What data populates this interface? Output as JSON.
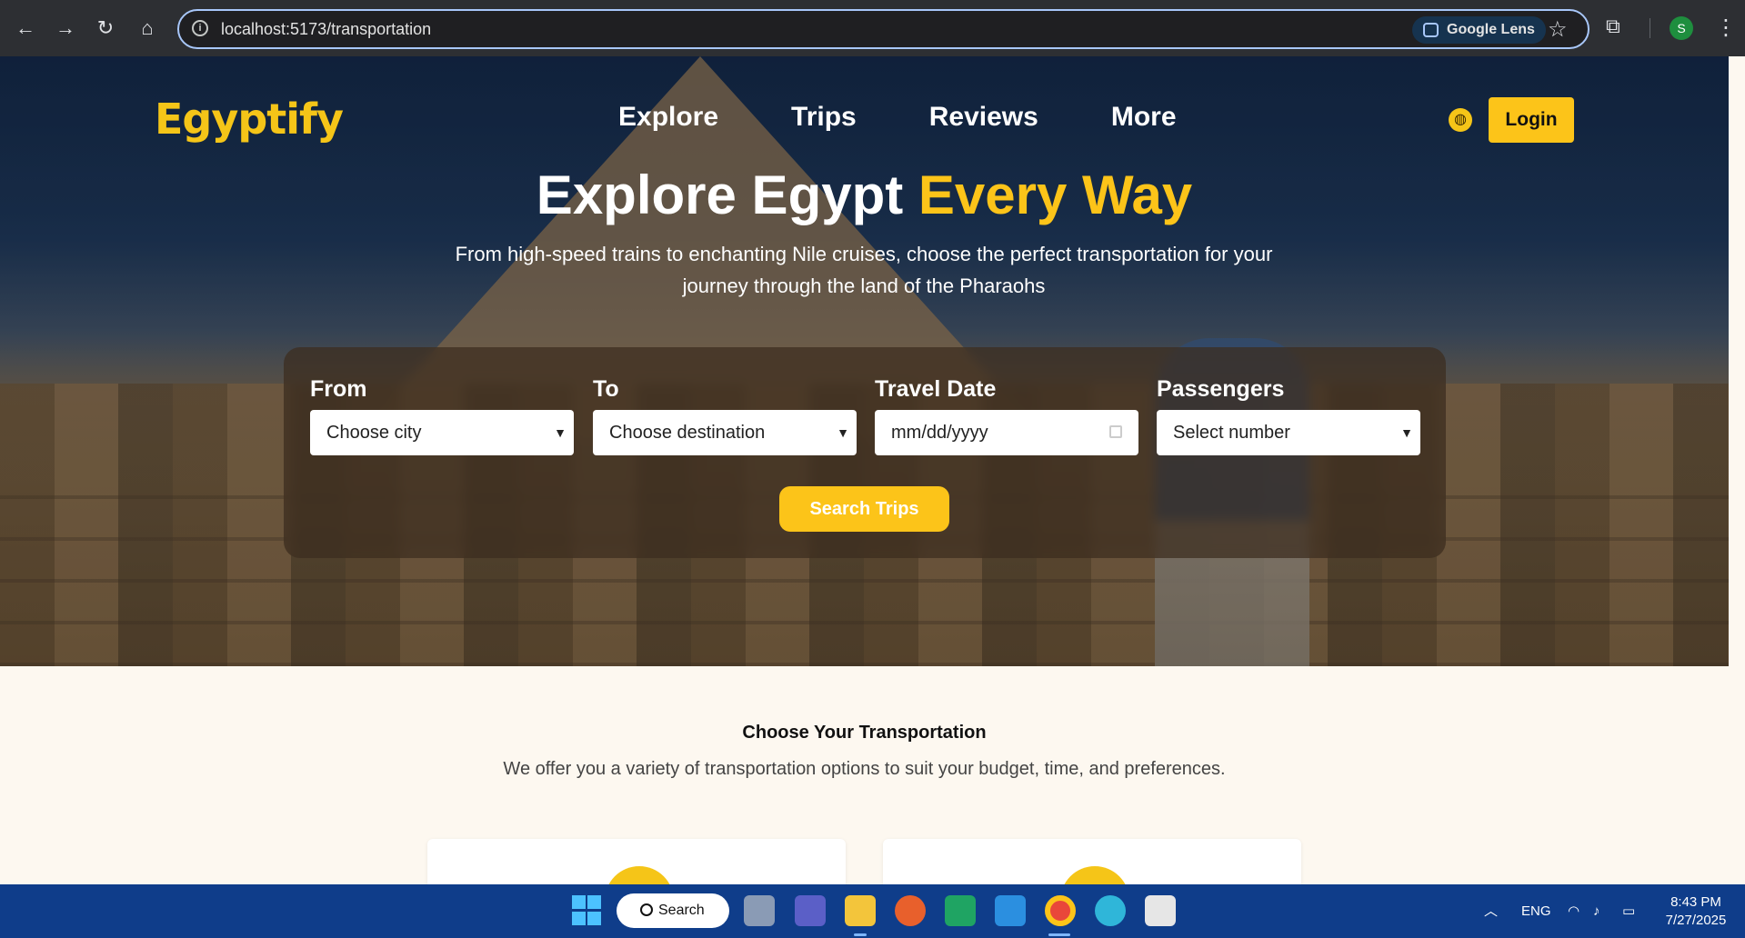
{
  "browser": {
    "url": "localhost:5173/transportation",
    "lens_label": "Google Lens",
    "profile_initial": "S"
  },
  "header": {
    "logo_text": "Egyptify",
    "nav": [
      "Explore",
      "Trips",
      "Reviews",
      "More"
    ],
    "login_label": "Login"
  },
  "hero": {
    "title_main": "Explore Egypt",
    "title_accent": "Every Way",
    "subtitle": "From high-speed trains to enchanting Nile cruises, choose the perfect transportation for your journey through the land of the Pharaohs"
  },
  "search_form": {
    "from_label": "From",
    "from_value": "Choose city",
    "to_label": "To",
    "to_value": "Choose destination",
    "date_label": "Travel Date",
    "date_placeholder": "mm/dd/yyyy",
    "passengers_label": "Passengers",
    "passengers_value": "Select number",
    "search_label": "Search Trips"
  },
  "transport_section": {
    "title": "Choose Your Transportation",
    "subtitle": "We offer you a variety of transportation options to suit your budget, time, and preferences."
  },
  "taskbar": {
    "search_label": "Search",
    "language": "ENG",
    "time": "8:43 PM",
    "date": "7/27/2025"
  },
  "colors": {
    "accent": "#fcc419",
    "taskbar": "#0f3d8a",
    "page_bg": "#fdf8f0"
  }
}
